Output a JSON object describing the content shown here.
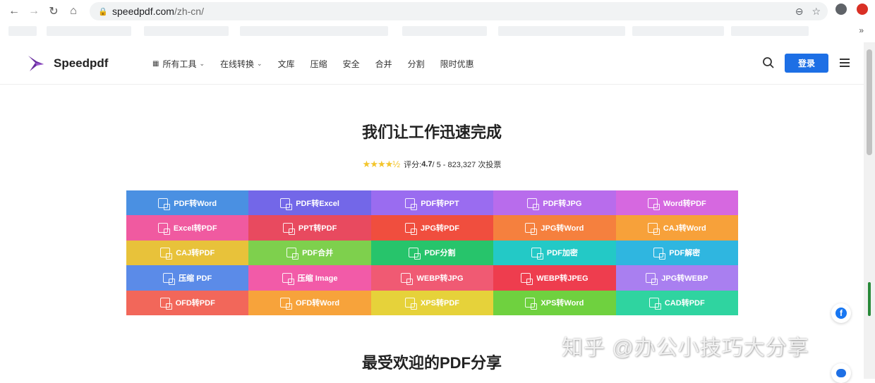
{
  "browser": {
    "url_host": "speedpdf.com",
    "url_path": "/zh-cn/",
    "bookmarks_more": "»"
  },
  "header": {
    "logo_text": "Speedpdf",
    "menu": [
      {
        "label": "所有工具",
        "has_caret": true,
        "has_grid_icon": true
      },
      {
        "label": "在线转换",
        "has_caret": true
      },
      {
        "label": "文库"
      },
      {
        "label": "压缩"
      },
      {
        "label": "安全"
      },
      {
        "label": "合并"
      },
      {
        "label": "分割"
      },
      {
        "label": "限时优惠"
      }
    ],
    "login_label": "登录",
    "accent_color": "#1d6fe5"
  },
  "hero": {
    "title": "我们让工作迅速完成",
    "rating_prefix": "评分: ",
    "rating_value": "4.7",
    "rating_suffix": " / 5 - 823,327 次投票",
    "stars": "★★★★½"
  },
  "tools": [
    {
      "label": "PDF转Word",
      "color": "#4a90e2"
    },
    {
      "label": "PDF转Excel",
      "color": "#7367e8"
    },
    {
      "label": "PDF转PPT",
      "color": "#9a6cf0"
    },
    {
      "label": "PDF转JPG",
      "color": "#b86cec"
    },
    {
      "label": "Word转PDF",
      "color": "#d668e0"
    },
    {
      "label": "Excel转PDF",
      "color": "#f05aa0"
    },
    {
      "label": "PPT转PDF",
      "color": "#e84a5f"
    },
    {
      "label": "JPG转PDF",
      "color": "#f04e3e"
    },
    {
      "label": "JPG转Word",
      "color": "#f5803e"
    },
    {
      "label": "CAJ转Word",
      "color": "#f7a13a"
    },
    {
      "label": "CAJ转PDF",
      "color": "#e8c23a"
    },
    {
      "label": "PDF合并",
      "color": "#7ed04d"
    },
    {
      "label": "PDF分割",
      "color": "#27c46b"
    },
    {
      "label": "PDF加密",
      "color": "#23c9c6"
    },
    {
      "label": "PDF解密",
      "color": "#2fb6e0"
    },
    {
      "label": "压缩 PDF",
      "color": "#5b8be8"
    },
    {
      "label": "压缩 Image",
      "color": "#f25ba8"
    },
    {
      "label": "WEBP转JPG",
      "color": "#f05a73"
    },
    {
      "label": "WEBP转JPEG",
      "color": "#ee3d4e"
    },
    {
      "label": "JPG转WEBP",
      "color": "#a97ff0"
    },
    {
      "label": "OFD转PDF",
      "color": "#f2675a"
    },
    {
      "label": "OFD转Word",
      "color": "#f7a33b"
    },
    {
      "label": "XPS转PDF",
      "color": "#e6d23a"
    },
    {
      "label": "XPS转Word",
      "color": "#6fd13f"
    },
    {
      "label": "CAD转PDF",
      "color": "#2fd4a0"
    }
  ],
  "section": {
    "title": "最受欢迎的PDF分享"
  },
  "watermark": "知乎 @办公小技巧大分享",
  "floating": {
    "fb_label": "f"
  }
}
